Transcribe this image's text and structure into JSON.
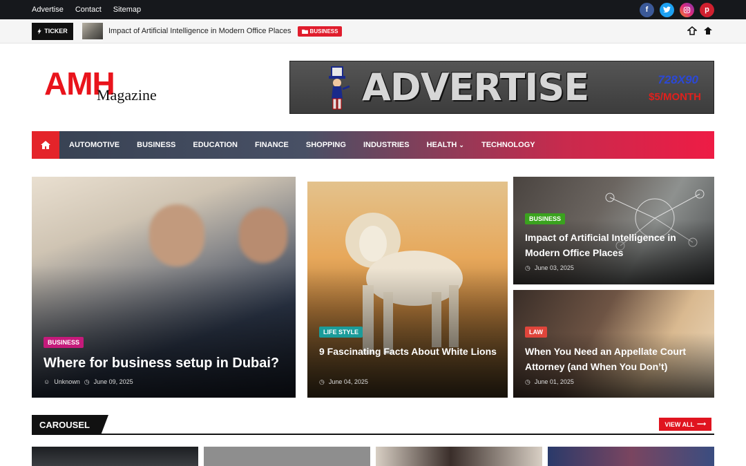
{
  "topbar": {
    "links": [
      "Advertise",
      "Contact",
      "Sitemap"
    ],
    "social": [
      "facebook-icon",
      "twitter-icon",
      "instagram-icon",
      "pinterest-icon"
    ]
  },
  "ticker": {
    "label": "TICKER",
    "text": "Impact of Artificial Intelligence in Modern Office Places",
    "badge": "BUSINESS"
  },
  "logo": {
    "main": "AMH",
    "sub": "Magazine"
  },
  "ad": {
    "title": "ADVERTISE HERE!",
    "size": "728X90",
    "price": "$5/MONTH"
  },
  "nav": {
    "items": [
      "AUTOMOTIVE",
      "BUSINESS",
      "EDUCATION",
      "FINANCE",
      "SHOPPING",
      "INDUSTRIES",
      "HEALTH",
      "TECHNOLOGY"
    ]
  },
  "posts": [
    {
      "badge": "BUSINESS",
      "title": "Where for business setup in Dubai?",
      "author": "Unknown",
      "date": "June 09, 2025"
    },
    {
      "badge": "LIFE STYLE",
      "title": "9 Fascinating Facts About White Lions",
      "date": "June 04, 2025"
    },
    {
      "badge": "BUSINESS",
      "title": "Impact of Artificial Intelligence in Modern Office Places",
      "date": "June 03, 2025"
    },
    {
      "badge": "LAW",
      "title": "When You Need an Appellate Court Attorney (and When You Don’t)",
      "date": "June 01, 2025"
    }
  ],
  "carousel": {
    "title": "CAROUSEL",
    "view_all": "VIEW ALL"
  },
  "colors": {
    "accent": "#e4242a",
    "business": "#c51a7b",
    "lifestyle": "#1b9c9a",
    "business2": "#3aa21e",
    "law": "#e0453b"
  }
}
